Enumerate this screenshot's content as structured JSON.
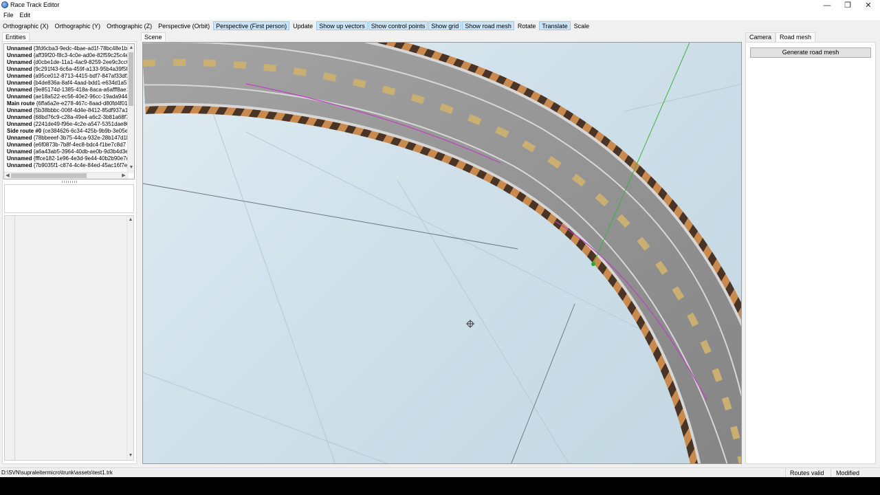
{
  "window": {
    "title": "Race Track Editor",
    "minimize_glyph": "—",
    "restore_glyph": "❐",
    "close_glyph": "✕"
  },
  "menu": [
    "File",
    "Edit"
  ],
  "toolbar": [
    {
      "label": "Orthographic (X)",
      "active": false
    },
    {
      "label": "Orthographic (Y)",
      "active": false
    },
    {
      "label": "Orthographic (Z)",
      "active": false
    },
    {
      "label": "Perspective (Orbit)",
      "active": false
    },
    {
      "label": "Perspective (First person)",
      "active": true
    },
    {
      "label": "Update",
      "active": false
    },
    {
      "label": "Show up vectors",
      "active": true
    },
    {
      "label": "Show control points",
      "active": true
    },
    {
      "label": "Show grid",
      "active": true
    },
    {
      "label": "Show road mesh",
      "active": true
    },
    {
      "label": "Rotate",
      "active": false
    },
    {
      "label": "Translate",
      "active": true
    },
    {
      "label": "Scale",
      "active": false
    }
  ],
  "entities_panel": {
    "tab_label": "Entities",
    "items": [
      {
        "name": "Unnamed",
        "id": "{3fd6cba3-9edc-4bae-ad1f-78bc48e1b"
      },
      {
        "name": "Unnamed",
        "id": "{aff39f20-f8c3-4c0e-ad0e-82f59c25c4e"
      },
      {
        "name": "Unnamed",
        "id": "{d0cbe1de-11a1-4ac9-8259-2ee9c3cc0"
      },
      {
        "name": "Unnamed",
        "id": "{9c291f43-6c6a-459f-a133-95b4a39f5f"
      },
      {
        "name": "Unnamed",
        "id": "{a95ce012-8713-4415-bdf7-847af33df2"
      },
      {
        "name": "Unnamed",
        "id": "{b4de836a-8af4-4aad-bdd1-e634d1a5b"
      },
      {
        "name": "Unnamed",
        "id": "{9e85174d-1385-418a-8aca-a6afff8ae1"
      },
      {
        "name": "Unnamed",
        "id": "{ae18a522-ec56-40e2-96cc-19ada9442"
      },
      {
        "name": "Main route",
        "id": "{6ffa6a2e-e278-467c-8aad-d80fd4f01"
      },
      {
        "name": "Unnamed",
        "id": "{5b38bbbc-006f-4d4e-8412-85df937a1"
      },
      {
        "name": "Unnamed",
        "id": "{68bd76c9-c28a-49e4-a6c2-3b81a68f7"
      },
      {
        "name": "Unnamed",
        "id": "{2241de49-f96e-4c2e-a547-5351dae80"
      },
      {
        "name": "Side route #0",
        "id": "{ce384626-6c34-425b-9b9b-3e05ef"
      },
      {
        "name": "Unnamed",
        "id": "{78bbeeef-3b75-44ca-932e-28b147d1b"
      },
      {
        "name": "Unnamed",
        "id": "{e6f0873b-7b8f-4ec8-bdc4-f1be7c8d7"
      },
      {
        "name": "Unnamed",
        "id": "{a6a43ab5-3964-40db-ae0b-9d3b4d3e"
      },
      {
        "name": "Unnamed",
        "id": "{fffce182-1e96-4e3d-9e44-40b2b90e7d"
      },
      {
        "name": "Unnamed",
        "id": "{7b9035f1-c874-4c4e-84ed-45ac16f7e0"
      }
    ]
  },
  "scene": {
    "tab_label": "Scene"
  },
  "right_panel": {
    "tabs": [
      {
        "label": "Camera",
        "selected": false
      },
      {
        "label": "Road mesh",
        "selected": true
      }
    ],
    "generate_button": "Generate road mesh"
  },
  "status": {
    "path": "D:\\SVN\\supraleitermicro\\trunk\\assets\\test1.trk",
    "routes": "Routes valid",
    "modified": "Modified"
  },
  "colors": {
    "active_button": "#cce4f7",
    "scene_bg": "#cfe0ea",
    "road": "#8e8e8e",
    "curb_orange": "#c98a4f",
    "curb_dark": "#4a3426",
    "route_line": "#c040c0",
    "up_vector": "#3cb13c"
  },
  "icons": [
    "app-icon",
    "move-cursor-icon",
    "scroll-up-arrow-icon",
    "scroll-down-arrow-icon",
    "scroll-left-arrow-icon",
    "scroll-right-arrow-icon"
  ]
}
